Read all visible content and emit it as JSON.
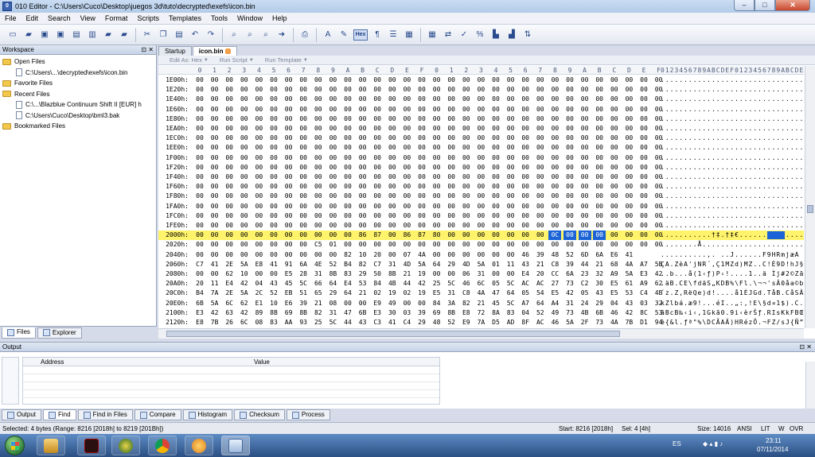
{
  "window": {
    "title": "010 Editor - C:\\Users\\Cuco\\Desktop\\juegos 3d\\tuto\\decrypted\\exefs\\icon.bin",
    "buttons": {
      "minimize": "–",
      "maximize": "□",
      "close": "✕"
    }
  },
  "menu": [
    "File",
    "Edit",
    "Search",
    "View",
    "Format",
    "Scripts",
    "Templates",
    "Tools",
    "Window",
    "Help"
  ],
  "workspace": {
    "title": "Workspace",
    "header_buttons": "⊡ ✕",
    "open_files": "Open Files",
    "open_file_1": "C:\\Users\\...\\decrypted\\exefs\\icon.bin",
    "favorite_files": "Favorite Files",
    "recent_files": "Recent Files",
    "recent_1": "C:\\...\\Blazblue Continuum Shift II [EUR] h",
    "recent_2": "C:\\Users\\Cuco\\Desktop\\bml3.bak",
    "bookmarked_files": "Bookmarked Files",
    "tab_files": "Files",
    "tab_explorer": "Explorer"
  },
  "editor": {
    "tab_startup": "Startup",
    "tab_file": "icon.bin",
    "edit_as": "Edit As: Hex",
    "run_script": "Run Script",
    "run_template": "Run Template",
    "col_headers": [
      "0",
      "1",
      "2",
      "3",
      "4",
      "5",
      "6",
      "7",
      "8",
      "9",
      "A",
      "B",
      "C",
      "D",
      "E",
      "F",
      "0",
      "1",
      "2",
      "3",
      "4",
      "5",
      "6",
      "7",
      "8",
      "9",
      "A",
      "B",
      "C",
      "D",
      "E",
      "F"
    ],
    "ascii_header": "0123456789ABCDEF0123456789ABCDEF",
    "rows": [
      {
        "addr": "1E00h:",
        "hex": "00 00 00 00 00 00 00 00 00 00 00 00 00 00 00 00 00 00 00 00 00 00 00 00 00 00 00 00 00 00 00 00",
        "ascii": "................................"
      },
      {
        "addr": "1E20h:",
        "hex": "00 00 00 00 00 00 00 00 00 00 00 00 00 00 00 00 00 00 00 00 00 00 00 00 00 00 00 00 00 00 00 00",
        "ascii": "................................"
      },
      {
        "addr": "1E40h:",
        "hex": "00 00 00 00 00 00 00 00 00 00 00 00 00 00 00 00 00 00 00 00 00 00 00 00 00 00 00 00 00 00 00 00",
        "ascii": "................................"
      },
      {
        "addr": "1E60h:",
        "hex": "00 00 00 00 00 00 00 00 00 00 00 00 00 00 00 00 00 00 00 00 00 00 00 00 00 00 00 00 00 00 00 00",
        "ascii": "................................"
      },
      {
        "addr": "1E80h:",
        "hex": "00 00 00 00 00 00 00 00 00 00 00 00 00 00 00 00 00 00 00 00 00 00 00 00 00 00 00 00 00 00 00 00",
        "ascii": "................................"
      },
      {
        "addr": "1EA0h:",
        "hex": "00 00 00 00 00 00 00 00 00 00 00 00 00 00 00 00 00 00 00 00 00 00 00 00 00 00 00 00 00 00 00 00",
        "ascii": "................................"
      },
      {
        "addr": "1EC0h:",
        "hex": "00 00 00 00 00 00 00 00 00 00 00 00 00 00 00 00 00 00 00 00 00 00 00 00 00 00 00 00 00 00 00 00",
        "ascii": "................................"
      },
      {
        "addr": "1EE0h:",
        "hex": "00 00 00 00 00 00 00 00 00 00 00 00 00 00 00 00 00 00 00 00 00 00 00 00 00 00 00 00 00 00 00 00",
        "ascii": "................................"
      },
      {
        "addr": "1F00h:",
        "hex": "00 00 00 00 00 00 00 00 00 00 00 00 00 00 00 00 00 00 00 00 00 00 00 00 00 00 00 00 00 00 00 00",
        "ascii": "................................"
      },
      {
        "addr": "1F20h:",
        "hex": "00 00 00 00 00 00 00 00 00 00 00 00 00 00 00 00 00 00 00 00 00 00 00 00 00 00 00 00 00 00 00 00",
        "ascii": "................................"
      },
      {
        "addr": "1F40h:",
        "hex": "00 00 00 00 00 00 00 00 00 00 00 00 00 00 00 00 00 00 00 00 00 00 00 00 00 00 00 00 00 00 00 00",
        "ascii": "................................"
      },
      {
        "addr": "1F60h:",
        "hex": "00 00 00 00 00 00 00 00 00 00 00 00 00 00 00 00 00 00 00 00 00 00 00 00 00 00 00 00 00 00 00 00",
        "ascii": "................................"
      },
      {
        "addr": "1F80h:",
        "hex": "00 00 00 00 00 00 00 00 00 00 00 00 00 00 00 00 00 00 00 00 00 00 00 00 00 00 00 00 00 00 00 00",
        "ascii": "................................"
      },
      {
        "addr": "1FA0h:",
        "hex": "00 00 00 00 00 00 00 00 00 00 00 00 00 00 00 00 00 00 00 00 00 00 00 00 00 00 00 00 00 00 00 00",
        "ascii": "................................"
      },
      {
        "addr": "1FC0h:",
        "hex": "00 00 00 00 00 00 00 00 00 00 00 00 00 00 00 00 00 00 00 00 00 00 00 00 00 00 00 00 00 00 00 00",
        "ascii": "................................"
      },
      {
        "addr": "1FE0h:",
        "hex": "00 00 00 00 00 00 00 00 00 00 00 00 00 00 00 00 00 00 00 00 00 00 00 00 00 00 00 00 00 00 00 00",
        "ascii": "................................"
      },
      {
        "addr": "2000h:",
        "hex": "00 00 00 00 00 00 00 00 00 00 00 86 87 00 86 87 80 00 00 00 00 00 00 00 0C 00 00 00 00 00 00 00",
        "ascii": "...........†‡.†‡€........ ......",
        "highlight": true
      },
      {
        "addr": "2020h:",
        "hex": "00 00 00 00 00 00 00 00 C5 01 00 00 00 00 00 00 00 00 00 00 00 00 00 00 00 00 00 00 00 00 00 00",
        "ascii": "........Å......................."
      },
      {
        "addr": "2040h:",
        "hex": "00 00 00 00 00 00 00 00 00 00 82 10 20 00 07 4A 00 00 00 00 00 00 46 39 48 52 6D 6A E6 41",
        "ascii": "..........‚. ..J......F9HRmjæA"
      },
      {
        "addr": "2060h:",
        "hex": "C7 41 2E 5A E8 41 91 6A 4E 52 B4 82 C7 31 4D 5A 64 29 4D 5A 01 11 43 21 C8 39 44 21 68 4A A7 5B",
        "ascii": "ÇA.ZèA'jNR´‚Ç1MZd)MZ..C!È9D!hJ§["
      },
      {
        "addr": "2080h:",
        "hex": "00 00 62 10 00 00 E5 28 31 8B 83 29 50 8B 21 19 00 00 06 31 00 00 E4 20 CC 6A 23 32 A9 5A E3 42",
        "ascii": "..b...å(1‹ƒ)P‹!....1..ä Ìj#2©ZãB"
      },
      {
        "addr": "20A0h:",
        "hex": "20 11 E4 42 04 43 45 5C 66 64 E4 53 84 4B 44 42 25 5C 46 6C 05 5C AC AC 27 73 C2 30 E5 61 A9 62",
        "ascii": " .äB.CE\\fdäS„KDB%\\Fl.\\¬¬'sÂ0åa©b"
      },
      {
        "addr": "20C0h:",
        "hex": "B4 7A 2E 5A 2C 52 EB 51 65 29 64 21 02 19 02 19 E5 31 C8 4A 47 64 05 54 E5 42 05 43 E5 53 C4 4B",
        "ascii": "´z.Z,RëQe)d!....å1ÈJGd.TåB.CåSÄK"
      },
      {
        "addr": "20E0h:",
        "hex": "6B 5A 6C 62 E1 10 E6 39 21 08 00 00 E9 49 00 00 84 3A 82 21 45 5C A7 64 A4 31 24 29 04 43 03 32",
        "ascii": "kZlbá.æ9!...éI..„:‚!E\\§d¤1$).C.2"
      },
      {
        "addr": "2100h:",
        "hex": "E3 42 63 42 89 8B 69 8B 82 31 47 6B E3 30 03 39 69 8B E8 72 8A 83 04 52 49 73 4B 6B 46 42 8C 53",
        "ascii": "ãBcB‰‹i‹‚1Gkã0.9i‹èrŠƒ.RIsKkFBŒS"
      },
      {
        "addr": "2120h:",
        "hex": "E8 7B 26 6C 08 83 AA 93 25 5C 44 43 C3 41 C4 29 48 52 E9 7A D5 AD 8F AC 46 5A 2F 73 4A 7B D1 94",
        "ascii": "è{&l.ƒª\"%\\DCÃAÄ)HRézÕ­.¬FZ/sJ{Ñ”"
      }
    ]
  },
  "output": {
    "title": "Output",
    "header_buttons": "⊡ ✕",
    "col_address": "Address",
    "col_value": "Value",
    "tabs": [
      "Output",
      "Find",
      "Find in Files",
      "Compare",
      "Histogram",
      "Checksum",
      "Process"
    ]
  },
  "status": {
    "selection": "Selected: 4 bytes (Range: 8216 [2018h] to 8219 [201Bh])",
    "start": "Start: 8216 [2018h]",
    "sel": "Sel: 4 [4h]",
    "size": "Size: 14016",
    "encoding": "ANSI",
    "endian": "LIT",
    "mode_w": "W",
    "mode_ovr": "OVR"
  },
  "taskbar": {
    "lang": "ES",
    "time": "23:11",
    "date": "07/11/2014"
  }
}
